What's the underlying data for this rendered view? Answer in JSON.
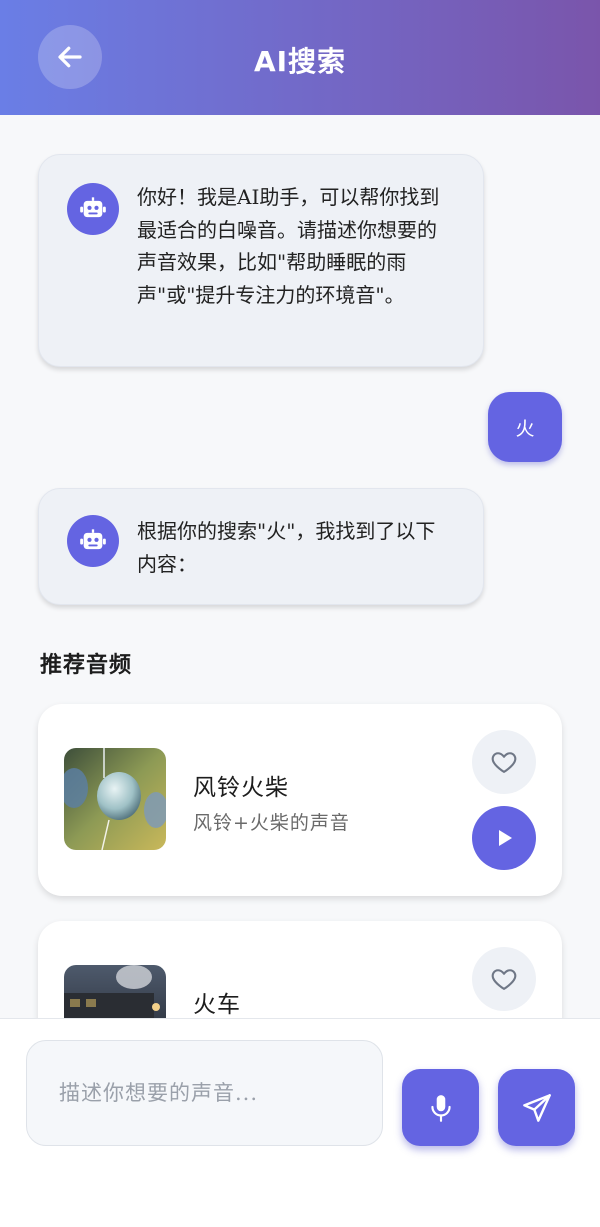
{
  "header": {
    "title": "AI搜索",
    "back_icon": "arrow-left-icon"
  },
  "messages": [
    {
      "role": "ai",
      "avatar_icon": "robot-icon",
      "text": "你好！我是AI助手，可以帮你找到最适合的白噪音。请描述你想要的声音效果，比如\"帮助睡眠的雨声\"或\"提升专注力的环境音\"。"
    },
    {
      "role": "user",
      "text": "火"
    },
    {
      "role": "ai",
      "avatar_icon": "robot-icon",
      "text": "根据你的搜索\"火\"，我找到了以下内容："
    }
  ],
  "recommendations": {
    "title": "推荐音频",
    "items": [
      {
        "title": "风铃火柴",
        "desc": "风铃+火柴的声音",
        "fav_icon": "heart-icon",
        "play_icon": "play-icon"
      },
      {
        "title": "火车",
        "desc": "",
        "fav_icon": "heart-icon"
      }
    ]
  },
  "input": {
    "placeholder": "描述你想要的声音...",
    "mic_icon": "microphone-icon",
    "send_icon": "send-icon"
  },
  "colors": {
    "accent": "#6464e2",
    "header_start": "#6a7ee6",
    "header_end": "#7a55ab"
  }
}
